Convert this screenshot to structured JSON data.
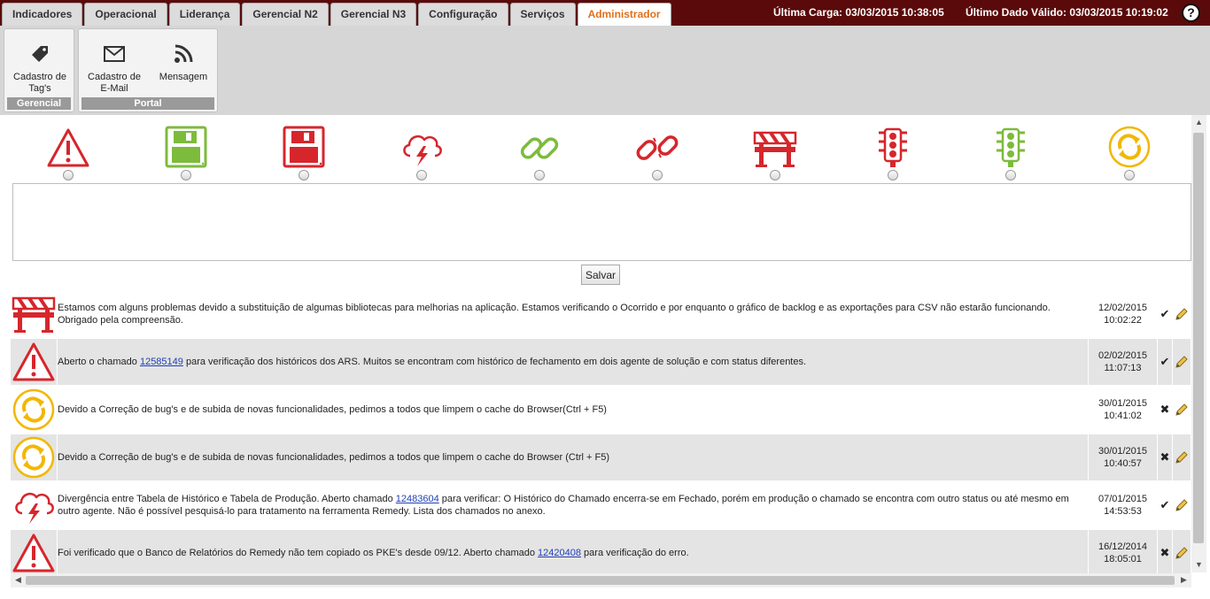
{
  "nav": {
    "tabs": [
      {
        "label": "Indicadores"
      },
      {
        "label": "Operacional"
      },
      {
        "label": "Liderança"
      },
      {
        "label": "Gerencial N2"
      },
      {
        "label": "Gerencial N3"
      },
      {
        "label": "Configuração"
      },
      {
        "label": "Serviços"
      },
      {
        "label": "Administrador",
        "active": true
      }
    ],
    "last_load": "Última Carga: 03/03/2015 10:38:05",
    "last_valid": "Último Dado Válido: 03/03/2015 10:19:02",
    "help": "?"
  },
  "ribbon": {
    "groups": [
      {
        "label": "Gerencial",
        "buttons": [
          {
            "label": "Cadastro de Tag's",
            "icon": "tag-icon"
          }
        ]
      },
      {
        "label": "Portal",
        "buttons": [
          {
            "label": "Cadastro de E-Mail",
            "icon": "envelope-icon"
          },
          {
            "label": "Mensagem",
            "icon": "rss-icon"
          }
        ]
      }
    ]
  },
  "icon_options": [
    {
      "icon": "warning-icon"
    },
    {
      "icon": "save-green-icon"
    },
    {
      "icon": "save-red-icon"
    },
    {
      "icon": "storm-icon"
    },
    {
      "icon": "link-green-icon"
    },
    {
      "icon": "broken-link-icon"
    },
    {
      "icon": "barrier-icon"
    },
    {
      "icon": "traffic-light-red-icon"
    },
    {
      "icon": "traffic-light-green-icon"
    },
    {
      "icon": "refresh-icon"
    }
  ],
  "editor": {
    "text": "",
    "save_label": "Salvar"
  },
  "messages": [
    {
      "icon": "barrier-icon",
      "text": "Estamos com alguns problemas devido a substituição de algumas bibliotecas para melhorias na aplicação. Estamos verificando o Ocorrido e por enquanto o gráfico de backlog e as exportações para CSV não estarão funcionando. Obrigado pela compreensão.",
      "date": "12/02/2015",
      "time": "10:02:22",
      "status": "✔"
    },
    {
      "icon": "warning-icon",
      "text_before": "Aberto o chamado ",
      "link": "12585149",
      "text_after": " para verificação dos históricos dos ARS. Muitos se encontram com histórico de fechamento em dois agente de solução e com status diferentes.",
      "date": "02/02/2015",
      "time": "11:07:13",
      "status": "✔"
    },
    {
      "icon": "refresh-icon",
      "text": "Devido a Correção de bug's e de subida de novas funcionalidades, pedimos a todos que limpem o cache do Browser(Ctrl + F5)",
      "date": "30/01/2015",
      "time": "10:41:02",
      "status": "✖"
    },
    {
      "icon": "refresh-icon",
      "text": "Devido a Correção de bug's e de subida de novas funcionalidades, pedimos a todos que limpem o cache do Browser (Ctrl + F5)",
      "date": "30/01/2015",
      "time": "10:40:57",
      "status": "✖"
    },
    {
      "icon": "storm-icon",
      "text_before": "Divergência entre Tabela de Histórico e Tabela de Produção. Aberto chamado ",
      "link": "12483604",
      "text_after": " para verificar: O Histórico do Chamado encerra-se em Fechado, porém em produção o chamado se encontra com outro status ou até mesmo em outro agente. Não é possível pesquisá-lo para tratamento na ferramenta Remedy. Lista dos chamados no anexo.",
      "date": "07/01/2015",
      "time": "14:53:53",
      "status": "✔"
    },
    {
      "icon": "warning-icon",
      "text_before": "Foi verificado que o Banco de Relatórios do Remedy não tem copiado os PKE's desde 09/12. Aberto chamado ",
      "link": "12420408",
      "text_after": " para verificação do erro.",
      "date": "16/12/2014",
      "time": "18:05:01",
      "status": "✖"
    }
  ],
  "colors": {
    "nav_bg": "#5a0a0a",
    "active_tab": "#e0701a",
    "red": "#d6262c",
    "green": "#7dbb3c",
    "yellow": "#f2b705"
  }
}
